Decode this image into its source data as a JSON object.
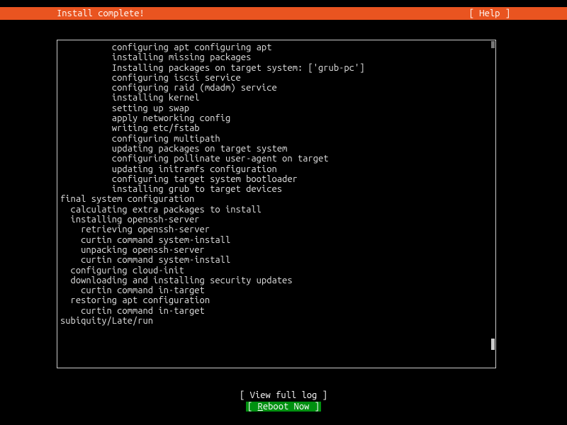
{
  "header": {
    "title": "Install complete!",
    "help": "[ Help ]"
  },
  "log": {
    "lines": [
      "          configuring apt configuring apt",
      "          installing missing packages",
      "          Installing packages on target system: ['grub-pc']",
      "          configuring iscsi service",
      "          configuring raid (mdadm) service",
      "          installing kernel",
      "          setting up swap",
      "          apply networking config",
      "          writing etc/fstab",
      "          configuring multipath",
      "          updating packages on target system",
      "          configuring pollinate user-agent on target",
      "          updating initramfs configuration",
      "          configuring target system bootloader",
      "          installing grub to target devices",
      "final system configuration",
      "  calculating extra packages to install",
      "  installing openssh-server",
      "    retrieving openssh-server",
      "    curtin command system-install",
      "    unpacking openssh-server",
      "    curtin command system-install",
      "  configuring cloud-init",
      "  downloading and installing security updates",
      "    curtin command in-target",
      "  restoring apt configuration",
      "    curtin command in-target",
      "subiquity/Late/run"
    ]
  },
  "buttons": {
    "view_log": "[ View full log ]",
    "reboot_prefix": "[ ",
    "reboot_key": "R",
    "reboot_rest": "eboot Now   ]"
  }
}
